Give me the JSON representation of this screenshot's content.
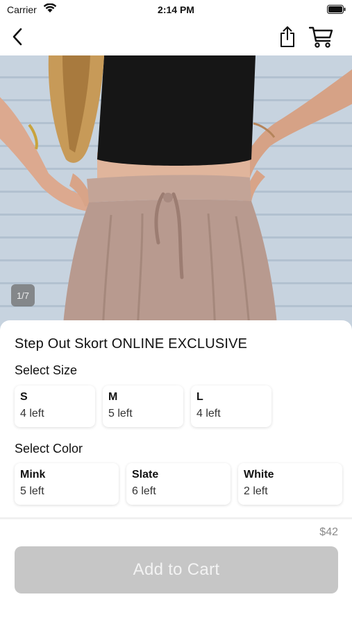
{
  "status_bar": {
    "carrier": "Carrier",
    "time": "2:14 PM"
  },
  "nav": {
    "back_icon": "chevron-left-icon",
    "share_icon": "share-icon",
    "cart_icon": "cart-icon"
  },
  "gallery": {
    "counter": "1/7"
  },
  "product": {
    "title": "Step Out Skort ONLINE EXCLUSIVE",
    "size_label": "Select Size",
    "sizes": [
      {
        "name": "S",
        "stock": "4 left"
      },
      {
        "name": "M",
        "stock": "5 left"
      },
      {
        "name": "L",
        "stock": "4 left"
      }
    ],
    "color_label": "Select Color",
    "colors": [
      {
        "name": "Mink",
        "stock": "5 left"
      },
      {
        "name": "Slate",
        "stock": "6 left"
      },
      {
        "name": "White",
        "stock": "2 left"
      }
    ],
    "price": "$42",
    "add_to_cart": "Add to Cart"
  },
  "colors": {
    "button_disabled": "#c6c6c6",
    "skort": "#b89a8f",
    "top": "#161616"
  }
}
